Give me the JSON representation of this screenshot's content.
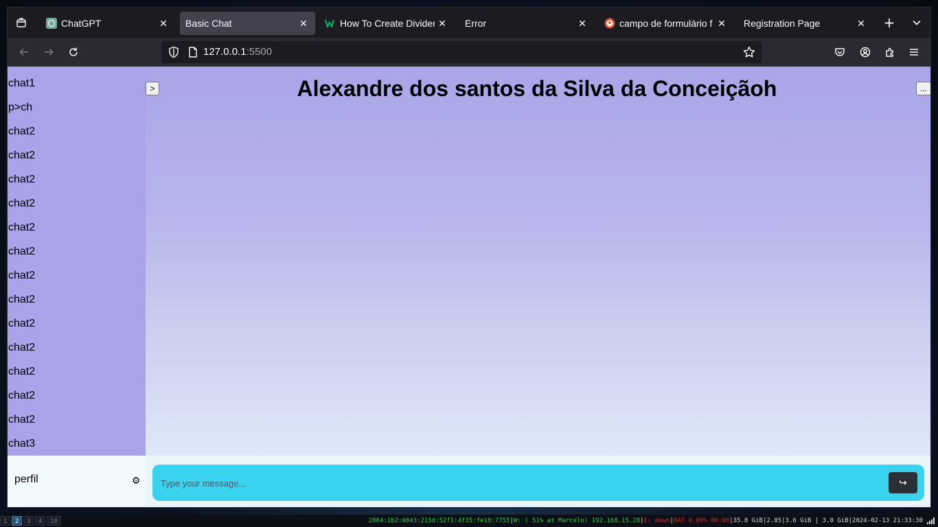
{
  "browser": {
    "tabs": [
      {
        "title": "ChatGPT",
        "icon": "chatgpt-icon",
        "active": false
      },
      {
        "title": "Basic Chat",
        "icon": "",
        "active": true
      },
      {
        "title": "How To Create Divider",
        "icon": "w3schools-icon",
        "active": false
      },
      {
        "title": "Error",
        "icon": "",
        "active": false
      },
      {
        "title": "campo de formulário f",
        "icon": "duckduckgo-icon",
        "active": false
      },
      {
        "title": "Registration Page",
        "icon": "",
        "active": false
      }
    ],
    "url_host": "127.0.0.1",
    "url_port": ":5500"
  },
  "page": {
    "title": "Alexandre dos santos da Silva da Conceiçãoh",
    "toggle_label": ">",
    "more_label": "...",
    "chats": [
      "chat1",
      "p>ch",
      "chat2",
      "chat2",
      "chat2",
      "chat2",
      "chat2",
      "chat2",
      "chat2",
      "chat2",
      "chat2",
      "chat2",
      "chat2",
      "chat2",
      "chat2",
      "chat3"
    ],
    "profile_label": "perfil",
    "settings_icon": "⚙",
    "message_placeholder": "Type your message...",
    "send_label": "↪"
  },
  "statusbar": {
    "workspaces": [
      "1",
      "2",
      "3",
      "4",
      "10"
    ],
    "active_workspace": "2",
    "ipv6": "2804:1b2:6043:215d:52f1:4f35:fe18:7755",
    "wifi": "W: ( 51% at Marcelo) 192.168.15.28",
    "ethernet": "E: down",
    "battery": "BAT 0.00% 00:00",
    "disk": "35.8 GiB",
    "load": "2.85",
    "memory": "3.6 GiB | 3.0 GiB",
    "datetime": "2024-02-13 21:33:30"
  }
}
